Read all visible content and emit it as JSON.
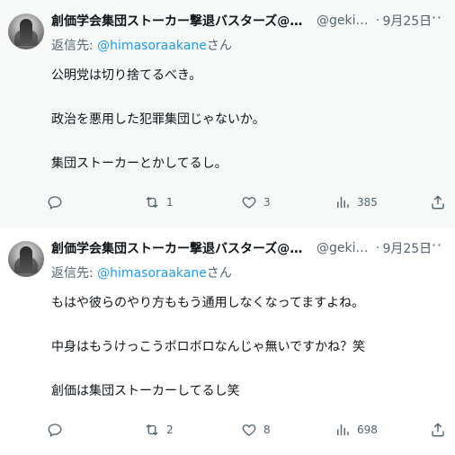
{
  "tweets": [
    {
      "name": "創価学会集団ストーカー撃退バスターズ@埼玉...",
      "handle": "@gekiba...",
      "separator": "·",
      "date": "9月25日",
      "reply_prefix": "返信先: ",
      "reply_mention": "@himasoraakane",
      "reply_suffix": "さん",
      "lines": [
        "公明党は切り捨てるべき。",
        "政治を悪用した犯罪集団じゃないか。",
        "集団ストーカーとかしてるし。"
      ],
      "reply_count": "",
      "retweet_count": "1",
      "like_count": "3",
      "view_count": "385"
    },
    {
      "name": "創価学会集団ストーカー撃退バスターズ@埼玉...",
      "handle": "@gekiba...",
      "separator": "·",
      "date": "9月25日",
      "reply_prefix": "返信先: ",
      "reply_mention": "@himasoraakane",
      "reply_suffix": "さん",
      "lines": [
        "もはや彼らのやり方ももう通用しなくなってますよね。",
        "中身はもうけっこうボロボロなんじゃ無いですかね？笑",
        "創価は集団ストーカーしてるし笑"
      ],
      "reply_count": "",
      "retweet_count": "2",
      "like_count": "8",
      "view_count": "698"
    }
  ],
  "icons": {
    "reply": "reply-icon",
    "retweet": "retweet-icon",
    "like": "heart-icon",
    "views": "analytics-icon",
    "share": "share-icon",
    "more": "more-icon"
  },
  "colors": {
    "accent": "#1d9bf0",
    "secondary_text": "#536471",
    "primary_text": "#0f1419",
    "highlight_background": "#f7f9f9"
  }
}
